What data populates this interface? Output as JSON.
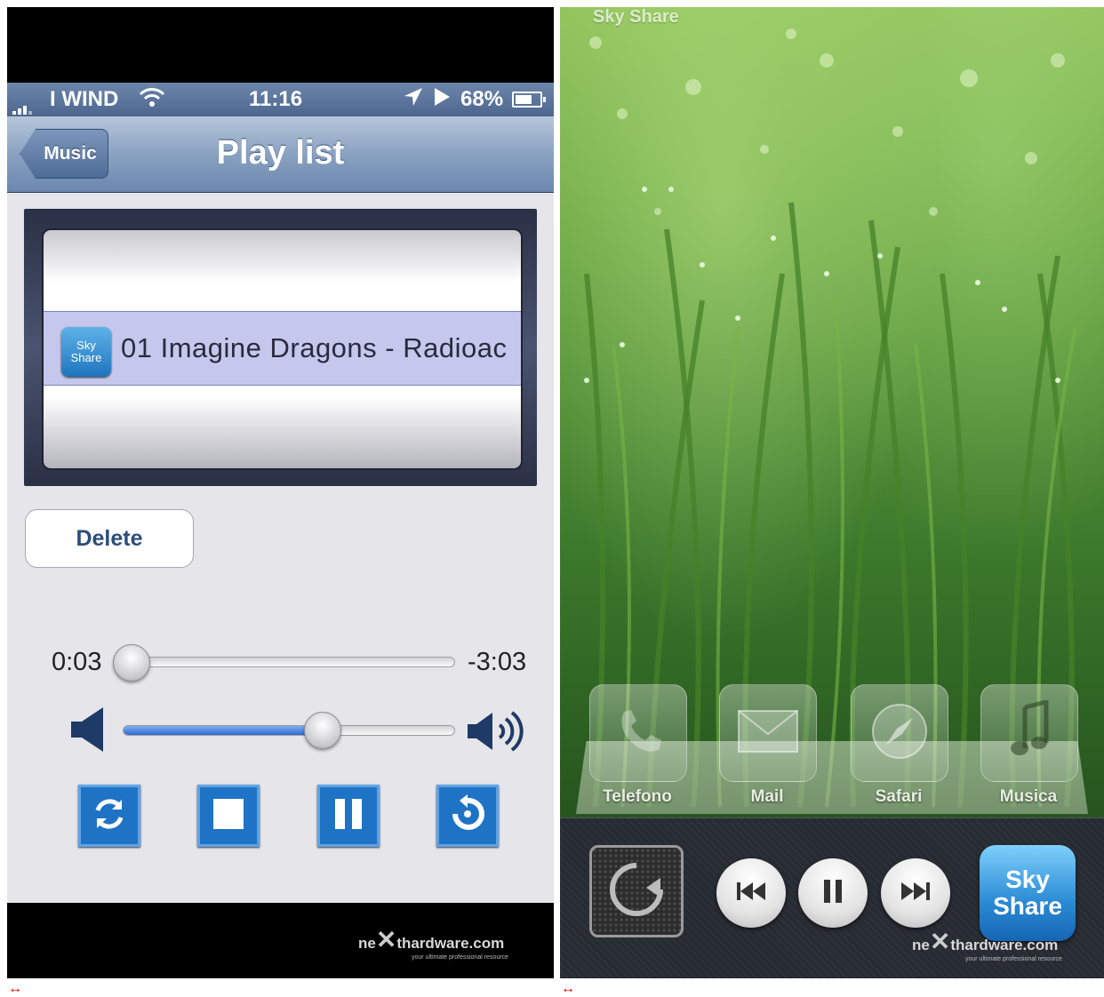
{
  "left": {
    "status": {
      "carrier": "I WIND",
      "time": "11:16",
      "battery": "68%"
    },
    "nav": {
      "back_label": "Music",
      "title": "Play list"
    },
    "picker": {
      "icon_line1": "Sky",
      "icon_line2": "Share",
      "track": "01 Imagine Dragons - Radioac"
    },
    "delete_label": "Delete",
    "player": {
      "elapsed": "0:03",
      "remaining": "-3:03",
      "progress": 0.02,
      "volume": 0.6
    },
    "watermark": {
      "brand_a": "ne",
      "brand_b": "thardware.com",
      "tagline": "your ultimate professional resource"
    }
  },
  "right": {
    "app_title": "Sky Share",
    "dock": [
      {
        "label": "Telefono",
        "icon": "phone-icon"
      },
      {
        "label": "Mail",
        "icon": "mail-icon"
      },
      {
        "label": "Safari",
        "icon": "compass-icon"
      },
      {
        "label": "Musica",
        "icon": "music-note-icon"
      }
    ],
    "switcher": {
      "app_line1": "Sky",
      "app_line2": "Share"
    },
    "watermark": {
      "brand_a": "ne",
      "brand_b": "thardware.com",
      "tagline": "your ultimate professional resource"
    }
  },
  "arrows": {
    "left": "↔",
    "right": "↔"
  }
}
